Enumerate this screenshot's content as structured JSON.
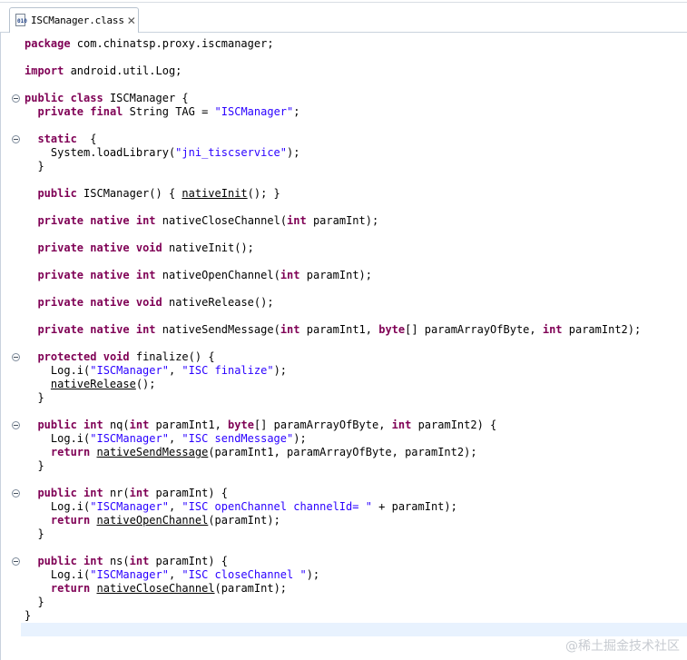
{
  "tab": {
    "title": "ISCManager.class",
    "icon": "class-file-icon",
    "close": "✕"
  },
  "code_lines": [
    [
      [
        "kw",
        "package"
      ],
      [
        "t",
        " com.chinatsp.proxy.iscmanager;"
      ]
    ],
    [],
    [
      [
        "kw",
        "import"
      ],
      [
        "t",
        " android.util.Log;"
      ]
    ],
    [],
    [
      [
        "kw",
        "public"
      ],
      [
        "t",
        " "
      ],
      [
        "kw",
        "class"
      ],
      [
        "t",
        " ISCManager {"
      ]
    ],
    [
      [
        "t",
        "  "
      ],
      [
        "kw",
        "private"
      ],
      [
        "t",
        " "
      ],
      [
        "kw",
        "final"
      ],
      [
        "t",
        " String TAG = "
      ],
      [
        "str",
        "\"ISCManager\""
      ],
      [
        "t",
        ";"
      ]
    ],
    [],
    [
      [
        "t",
        "  "
      ],
      [
        "kw",
        "static"
      ],
      [
        "t",
        "  {"
      ]
    ],
    [
      [
        "t",
        "    System.loadLibrary("
      ],
      [
        "str",
        "\"jni_tiscservice\""
      ],
      [
        "t",
        ");"
      ]
    ],
    [
      [
        "t",
        "  }"
      ]
    ],
    [],
    [
      [
        "t",
        "  "
      ],
      [
        "kw",
        "public"
      ],
      [
        "t",
        " ISCManager() { "
      ],
      [
        "ul",
        "nativeInit"
      ],
      [
        "t",
        "(); }"
      ]
    ],
    [],
    [
      [
        "t",
        "  "
      ],
      [
        "kw",
        "private"
      ],
      [
        "t",
        " "
      ],
      [
        "kw",
        "native"
      ],
      [
        "t",
        " "
      ],
      [
        "kw",
        "int"
      ],
      [
        "t",
        " nativeCloseChannel("
      ],
      [
        "kw",
        "int"
      ],
      [
        "t",
        " paramInt);"
      ]
    ],
    [],
    [
      [
        "t",
        "  "
      ],
      [
        "kw",
        "private"
      ],
      [
        "t",
        " "
      ],
      [
        "kw",
        "native"
      ],
      [
        "t",
        " "
      ],
      [
        "kw",
        "void"
      ],
      [
        "t",
        " nativeInit();"
      ]
    ],
    [],
    [
      [
        "t",
        "  "
      ],
      [
        "kw",
        "private"
      ],
      [
        "t",
        " "
      ],
      [
        "kw",
        "native"
      ],
      [
        "t",
        " "
      ],
      [
        "kw",
        "int"
      ],
      [
        "t",
        " nativeOpenChannel("
      ],
      [
        "kw",
        "int"
      ],
      [
        "t",
        " paramInt);"
      ]
    ],
    [],
    [
      [
        "t",
        "  "
      ],
      [
        "kw",
        "private"
      ],
      [
        "t",
        " "
      ],
      [
        "kw",
        "native"
      ],
      [
        "t",
        " "
      ],
      [
        "kw",
        "void"
      ],
      [
        "t",
        " nativeRelease();"
      ]
    ],
    [],
    [
      [
        "t",
        "  "
      ],
      [
        "kw",
        "private"
      ],
      [
        "t",
        " "
      ],
      [
        "kw",
        "native"
      ],
      [
        "t",
        " "
      ],
      [
        "kw",
        "int"
      ],
      [
        "t",
        " nativeSendMessage("
      ],
      [
        "kw",
        "int"
      ],
      [
        "t",
        " paramInt1, "
      ],
      [
        "kw",
        "byte"
      ],
      [
        "t",
        "[] paramArrayOfByte, "
      ],
      [
        "kw",
        "int"
      ],
      [
        "t",
        " paramInt2);"
      ]
    ],
    [],
    [
      [
        "t",
        "  "
      ],
      [
        "kw",
        "protected"
      ],
      [
        "t",
        " "
      ],
      [
        "kw",
        "void"
      ],
      [
        "t",
        " finalize() {"
      ]
    ],
    [
      [
        "t",
        "    Log.i("
      ],
      [
        "str",
        "\"ISCManager\""
      ],
      [
        "t",
        ", "
      ],
      [
        "str",
        "\"ISC finalize\""
      ],
      [
        "t",
        ");"
      ]
    ],
    [
      [
        "t",
        "    "
      ],
      [
        "ul",
        "nativeRelease"
      ],
      [
        "t",
        "();"
      ]
    ],
    [
      [
        "t",
        "  }"
      ]
    ],
    [],
    [
      [
        "t",
        "  "
      ],
      [
        "kw",
        "public"
      ],
      [
        "t",
        " "
      ],
      [
        "kw",
        "int"
      ],
      [
        "t",
        " nq("
      ],
      [
        "kw",
        "int"
      ],
      [
        "t",
        " paramInt1, "
      ],
      [
        "kw",
        "byte"
      ],
      [
        "t",
        "[] paramArrayOfByte, "
      ],
      [
        "kw",
        "int"
      ],
      [
        "t",
        " paramInt2) {"
      ]
    ],
    [
      [
        "t",
        "    Log.i("
      ],
      [
        "str",
        "\"ISCManager\""
      ],
      [
        "t",
        ", "
      ],
      [
        "str",
        "\"ISC sendMessage\""
      ],
      [
        "t",
        ");"
      ]
    ],
    [
      [
        "t",
        "    "
      ],
      [
        "kw",
        "return"
      ],
      [
        "t",
        " "
      ],
      [
        "ul",
        "nativeSendMessage"
      ],
      [
        "t",
        "(paramInt1, paramArrayOfByte, paramInt2);"
      ]
    ],
    [
      [
        "t",
        "  }"
      ]
    ],
    [],
    [
      [
        "t",
        "  "
      ],
      [
        "kw",
        "public"
      ],
      [
        "t",
        " "
      ],
      [
        "kw",
        "int"
      ],
      [
        "t",
        " nr("
      ],
      [
        "kw",
        "int"
      ],
      [
        "t",
        " paramInt) {"
      ]
    ],
    [
      [
        "t",
        "    Log.i("
      ],
      [
        "str",
        "\"ISCManager\""
      ],
      [
        "t",
        ", "
      ],
      [
        "str",
        "\"ISC openChannel channelId= \""
      ],
      [
        "t",
        " + paramInt);"
      ]
    ],
    [
      [
        "t",
        "    "
      ],
      [
        "kw",
        "return"
      ],
      [
        "t",
        " "
      ],
      [
        "ul",
        "nativeOpenChannel"
      ],
      [
        "t",
        "(paramInt);"
      ]
    ],
    [
      [
        "t",
        "  }"
      ]
    ],
    [],
    [
      [
        "t",
        "  "
      ],
      [
        "kw",
        "public"
      ],
      [
        "t",
        " "
      ],
      [
        "kw",
        "int"
      ],
      [
        "t",
        " ns("
      ],
      [
        "kw",
        "int"
      ],
      [
        "t",
        " paramInt) {"
      ]
    ],
    [
      [
        "t",
        "    Log.i("
      ],
      [
        "str",
        "\"ISCManager\""
      ],
      [
        "t",
        ", "
      ],
      [
        "str",
        "\"ISC closeChannel \""
      ],
      [
        "t",
        ");"
      ]
    ],
    [
      [
        "t",
        "    "
      ],
      [
        "kw",
        "return"
      ],
      [
        "t",
        " "
      ],
      [
        "ul",
        "nativeCloseChannel"
      ],
      [
        "t",
        "(paramInt);"
      ]
    ],
    [
      [
        "t",
        "  }"
      ]
    ],
    [
      [
        "t",
        "}"
      ]
    ],
    []
  ],
  "fold_lines": [
    4,
    7,
    23,
    28,
    33,
    38
  ],
  "colors": {
    "keyword": "#7f0055",
    "string": "#2a00ff",
    "current_line": "#e8f2fe"
  },
  "watermark": "@稀土掘金技术社区"
}
